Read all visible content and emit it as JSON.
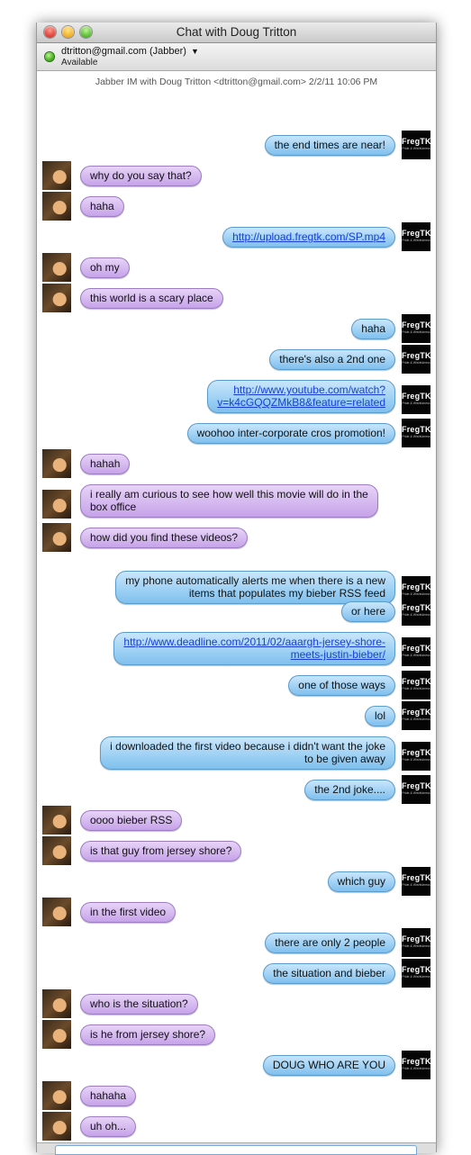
{
  "window": {
    "title": "Chat with Doug Tritton"
  },
  "account": {
    "name": "dtritton@gmail.com (Jabber)",
    "status": "Available"
  },
  "chat_header": "Jabber IM with Doug Tritton <dtritton@gmail.com>  2/2/11 10:06 PM",
  "my_avatar": {
    "brand": "FregTK",
    "sub": "Pride & Wishfulness"
  },
  "messages": [
    {
      "from": "me",
      "text": "the end times are near!"
    },
    {
      "from": "them",
      "text": "why do you say that?"
    },
    {
      "from": "them",
      "text": "haha"
    },
    {
      "from": "me",
      "text": "http://upload.fregtk.com/SP.mp4",
      "link": true
    },
    {
      "from": "them",
      "text": "oh my"
    },
    {
      "from": "them",
      "text": "this world is a scary place"
    },
    {
      "from": "me",
      "text": "haha"
    },
    {
      "from": "me",
      "text": "there's also a 2nd one"
    },
    {
      "from": "me",
      "text": "http://www.youtube.com/watch?\nv=k4cGQQZMkB8&feature=related",
      "link": true
    },
    {
      "from": "me",
      "text": "woohoo inter-corporate cros promotion!"
    },
    {
      "from": "them",
      "text": "hahah"
    },
    {
      "from": "them",
      "text": "i really am curious to see how well this movie will do in the\nbox office"
    },
    {
      "from": "them",
      "text": "how did you find these videos?"
    },
    {
      "from": "me",
      "text": "my phone automatically alerts me when there is a new\nitems that populates my bieber RSS feed"
    },
    {
      "from": "me",
      "text": "or here"
    },
    {
      "from": "me",
      "text": "http://www.deadline.com/2011/02/aaargh-jersey-shore-\nmeets-justin-bieber/",
      "link": true
    },
    {
      "from": "me",
      "text": "one of those ways"
    },
    {
      "from": "me",
      "text": "lol"
    },
    {
      "from": "me",
      "text": "i downloaded the first video because i didn't want the joke\nto be given away"
    },
    {
      "from": "me",
      "text": "the 2nd joke...."
    },
    {
      "from": "them",
      "text": "oooo bieber RSS"
    },
    {
      "from": "them",
      "text": "is that guy from jersey shore?"
    },
    {
      "from": "me",
      "text": "which guy"
    },
    {
      "from": "them",
      "text": "in the first video"
    },
    {
      "from": "me",
      "text": "there are only 2 people"
    },
    {
      "from": "me",
      "text": "the situation and bieber"
    },
    {
      "from": "them",
      "text": "who is the situation?"
    },
    {
      "from": "them",
      "text": "is he from jersey shore?"
    },
    {
      "from": "me",
      "text": "DOUG WHO ARE YOU"
    },
    {
      "from": "them",
      "text": "hahaha"
    },
    {
      "from": "them",
      "text": "uh oh..."
    }
  ]
}
